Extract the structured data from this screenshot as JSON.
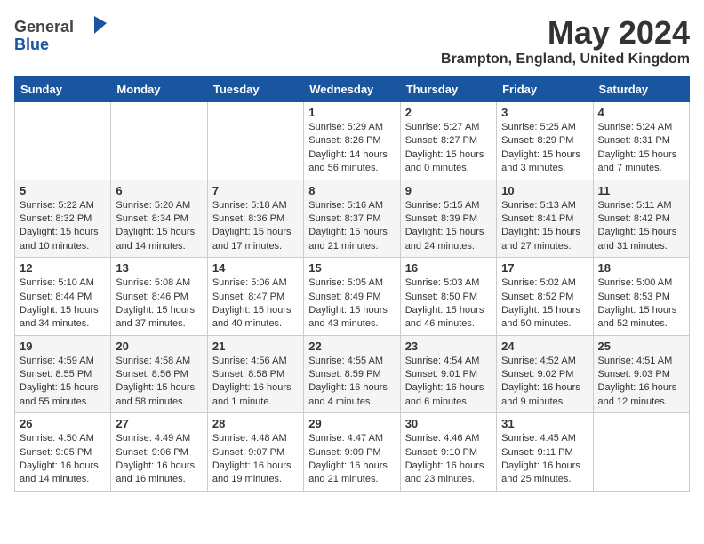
{
  "header": {
    "logo_general": "General",
    "logo_blue": "Blue",
    "title": "May 2024",
    "location": "Brampton, England, United Kingdom"
  },
  "weekdays": [
    "Sunday",
    "Monday",
    "Tuesday",
    "Wednesday",
    "Thursday",
    "Friday",
    "Saturday"
  ],
  "weeks": [
    [
      {
        "day": "",
        "info": ""
      },
      {
        "day": "",
        "info": ""
      },
      {
        "day": "",
        "info": ""
      },
      {
        "day": "1",
        "info": "Sunrise: 5:29 AM\nSunset: 8:26 PM\nDaylight: 14 hours\nand 56 minutes."
      },
      {
        "day": "2",
        "info": "Sunrise: 5:27 AM\nSunset: 8:27 PM\nDaylight: 15 hours\nand 0 minutes."
      },
      {
        "day": "3",
        "info": "Sunrise: 5:25 AM\nSunset: 8:29 PM\nDaylight: 15 hours\nand 3 minutes."
      },
      {
        "day": "4",
        "info": "Sunrise: 5:24 AM\nSunset: 8:31 PM\nDaylight: 15 hours\nand 7 minutes."
      }
    ],
    [
      {
        "day": "5",
        "info": "Sunrise: 5:22 AM\nSunset: 8:32 PM\nDaylight: 15 hours\nand 10 minutes."
      },
      {
        "day": "6",
        "info": "Sunrise: 5:20 AM\nSunset: 8:34 PM\nDaylight: 15 hours\nand 14 minutes."
      },
      {
        "day": "7",
        "info": "Sunrise: 5:18 AM\nSunset: 8:36 PM\nDaylight: 15 hours\nand 17 minutes."
      },
      {
        "day": "8",
        "info": "Sunrise: 5:16 AM\nSunset: 8:37 PM\nDaylight: 15 hours\nand 21 minutes."
      },
      {
        "day": "9",
        "info": "Sunrise: 5:15 AM\nSunset: 8:39 PM\nDaylight: 15 hours\nand 24 minutes."
      },
      {
        "day": "10",
        "info": "Sunrise: 5:13 AM\nSunset: 8:41 PM\nDaylight: 15 hours\nand 27 minutes."
      },
      {
        "day": "11",
        "info": "Sunrise: 5:11 AM\nSunset: 8:42 PM\nDaylight: 15 hours\nand 31 minutes."
      }
    ],
    [
      {
        "day": "12",
        "info": "Sunrise: 5:10 AM\nSunset: 8:44 PM\nDaylight: 15 hours\nand 34 minutes."
      },
      {
        "day": "13",
        "info": "Sunrise: 5:08 AM\nSunset: 8:46 PM\nDaylight: 15 hours\nand 37 minutes."
      },
      {
        "day": "14",
        "info": "Sunrise: 5:06 AM\nSunset: 8:47 PM\nDaylight: 15 hours\nand 40 minutes."
      },
      {
        "day": "15",
        "info": "Sunrise: 5:05 AM\nSunset: 8:49 PM\nDaylight: 15 hours\nand 43 minutes."
      },
      {
        "day": "16",
        "info": "Sunrise: 5:03 AM\nSunset: 8:50 PM\nDaylight: 15 hours\nand 46 minutes."
      },
      {
        "day": "17",
        "info": "Sunrise: 5:02 AM\nSunset: 8:52 PM\nDaylight: 15 hours\nand 50 minutes."
      },
      {
        "day": "18",
        "info": "Sunrise: 5:00 AM\nSunset: 8:53 PM\nDaylight: 15 hours\nand 52 minutes."
      }
    ],
    [
      {
        "day": "19",
        "info": "Sunrise: 4:59 AM\nSunset: 8:55 PM\nDaylight: 15 hours\nand 55 minutes."
      },
      {
        "day": "20",
        "info": "Sunrise: 4:58 AM\nSunset: 8:56 PM\nDaylight: 15 hours\nand 58 minutes."
      },
      {
        "day": "21",
        "info": "Sunrise: 4:56 AM\nSunset: 8:58 PM\nDaylight: 16 hours\nand 1 minute."
      },
      {
        "day": "22",
        "info": "Sunrise: 4:55 AM\nSunset: 8:59 PM\nDaylight: 16 hours\nand 4 minutes."
      },
      {
        "day": "23",
        "info": "Sunrise: 4:54 AM\nSunset: 9:01 PM\nDaylight: 16 hours\nand 6 minutes."
      },
      {
        "day": "24",
        "info": "Sunrise: 4:52 AM\nSunset: 9:02 PM\nDaylight: 16 hours\nand 9 minutes."
      },
      {
        "day": "25",
        "info": "Sunrise: 4:51 AM\nSunset: 9:03 PM\nDaylight: 16 hours\nand 12 minutes."
      }
    ],
    [
      {
        "day": "26",
        "info": "Sunrise: 4:50 AM\nSunset: 9:05 PM\nDaylight: 16 hours\nand 14 minutes."
      },
      {
        "day": "27",
        "info": "Sunrise: 4:49 AM\nSunset: 9:06 PM\nDaylight: 16 hours\nand 16 minutes."
      },
      {
        "day": "28",
        "info": "Sunrise: 4:48 AM\nSunset: 9:07 PM\nDaylight: 16 hours\nand 19 minutes."
      },
      {
        "day": "29",
        "info": "Sunrise: 4:47 AM\nSunset: 9:09 PM\nDaylight: 16 hours\nand 21 minutes."
      },
      {
        "day": "30",
        "info": "Sunrise: 4:46 AM\nSunset: 9:10 PM\nDaylight: 16 hours\nand 23 minutes."
      },
      {
        "day": "31",
        "info": "Sunrise: 4:45 AM\nSunset: 9:11 PM\nDaylight: 16 hours\nand 25 minutes."
      },
      {
        "day": "",
        "info": ""
      }
    ]
  ]
}
